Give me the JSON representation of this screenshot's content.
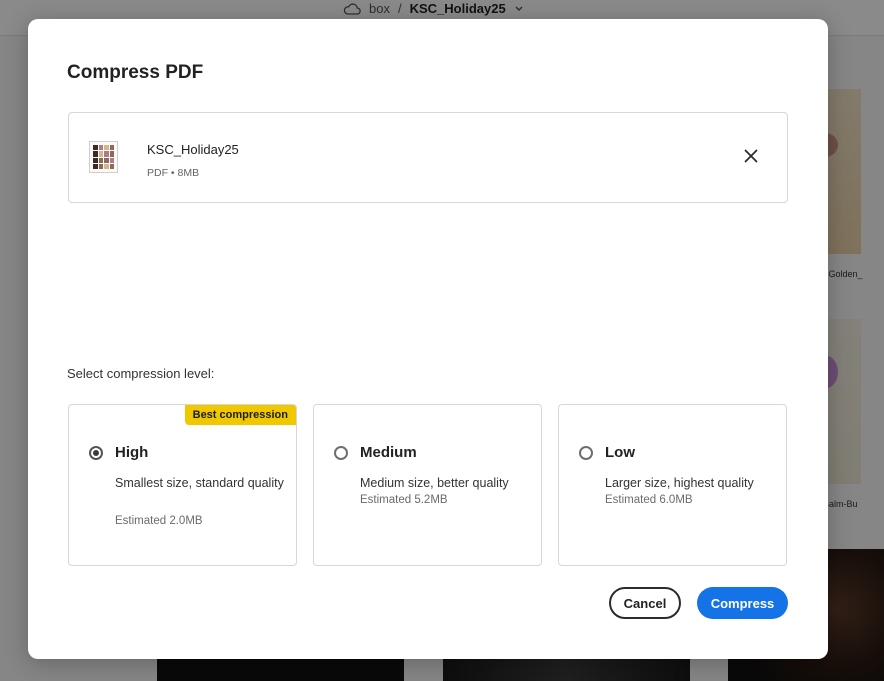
{
  "background": {
    "breadcrumb": {
      "root": "box",
      "separator": "/",
      "current": "KSC_Holiday25"
    },
    "captions": [
      "mLip-Golden_",
      "dLipBalm-Bu"
    ]
  },
  "dialog": {
    "title": "Compress PDF",
    "file": {
      "name": "KSC_Holiday25",
      "meta": "PDF • 8MB"
    },
    "section_label": "Select compression level:",
    "options": [
      {
        "title": "High",
        "description": "Smallest size, standard quality",
        "estimate": "Estimated 2.0MB",
        "badge": "Best compression",
        "selected": true
      },
      {
        "title": "Medium",
        "description": "Medium size, better quality",
        "estimate": "Estimated 5.2MB",
        "selected": false
      },
      {
        "title": "Low",
        "description": "Larger size, highest quality",
        "estimate": "Estimated 6.0MB",
        "selected": false
      }
    ],
    "buttons": {
      "cancel": "Cancel",
      "compress": "Compress"
    },
    "icons": {
      "close": "close-icon",
      "file": "pdf-thumbnail",
      "cloud": "cloud-icon",
      "chevron": "chevron-down-icon"
    }
  },
  "colors": {
    "primary": "#1473e6",
    "badge": "#f0c800",
    "overlay": "rgba(0,0,0,0.45)"
  }
}
